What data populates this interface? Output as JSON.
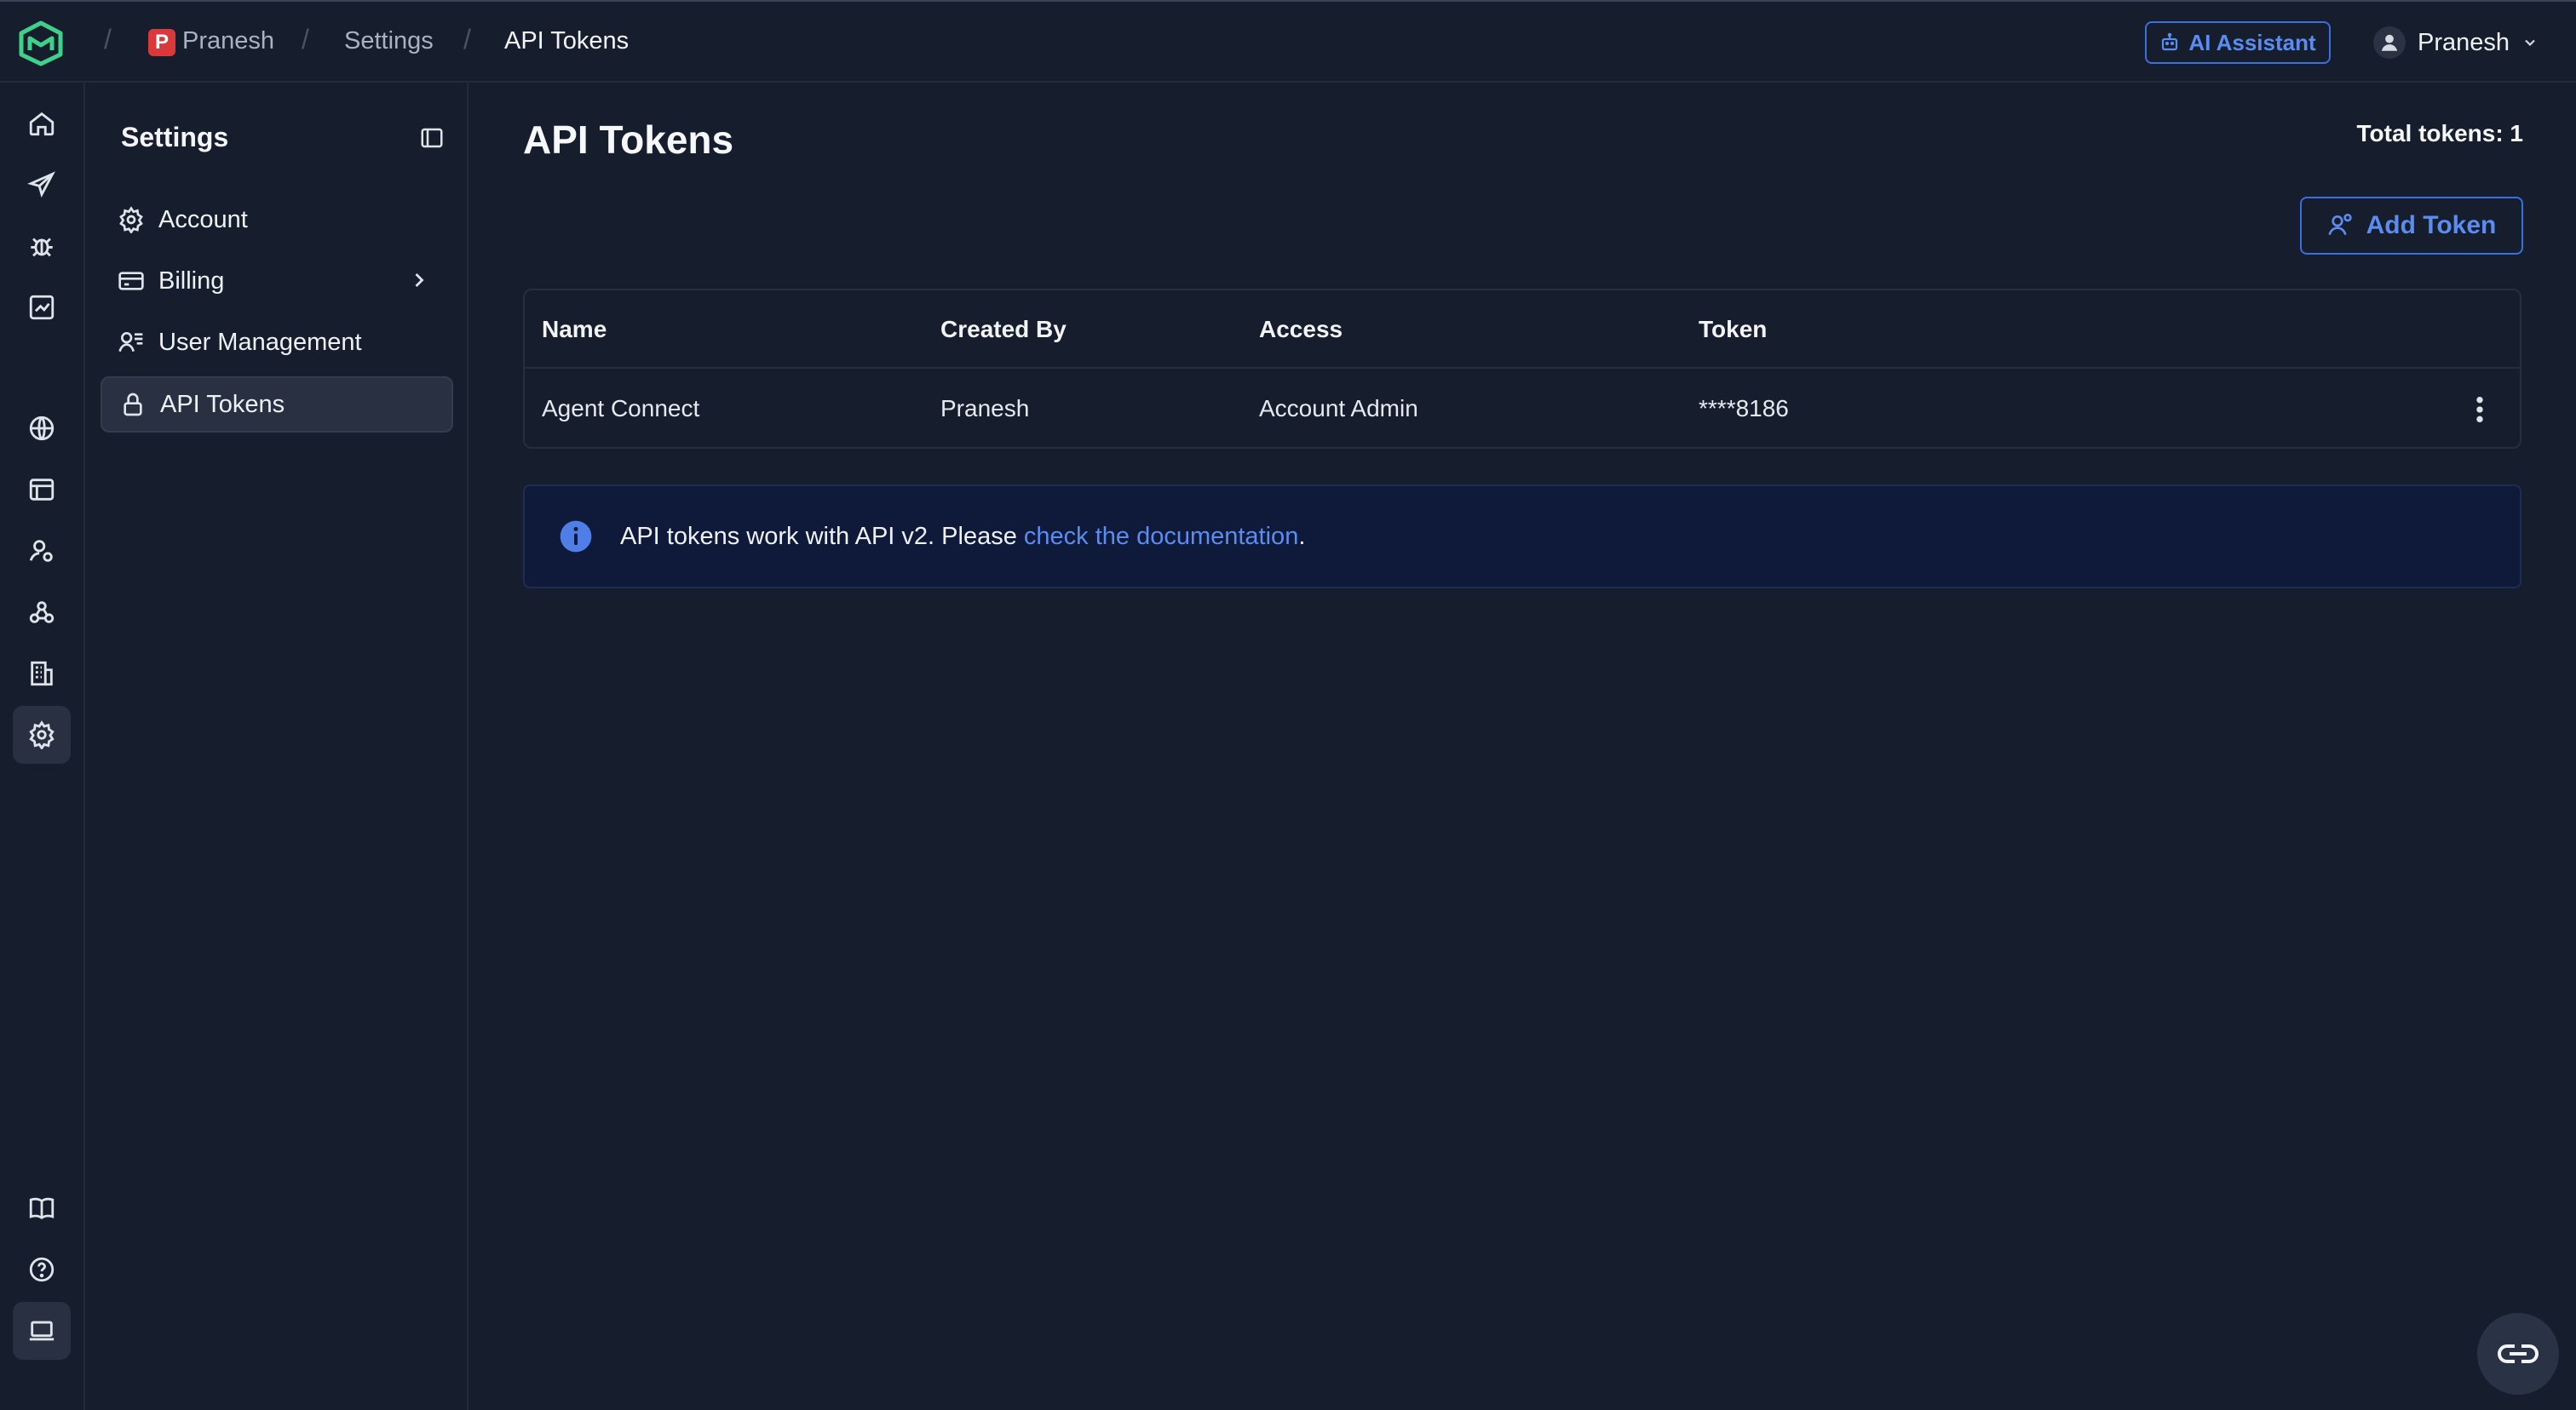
{
  "breadcrumb": {
    "org_initial": "P",
    "org_name": "Pranesh",
    "section": "Settings",
    "current": "API Tokens"
  },
  "header": {
    "ai_assistant_label": "AI Assistant",
    "user_name": "Pranesh"
  },
  "rail": {
    "items": [
      "home-icon",
      "send-icon",
      "bug-icon",
      "chart-icon",
      "globe-icon",
      "layout-icon",
      "user-settings-icon",
      "webhook-icon",
      "building-icon",
      "gear-icon",
      "book-icon",
      "help-icon",
      "monitor-icon"
    ],
    "active": "gear-icon"
  },
  "sidebar": {
    "title": "Settings",
    "items": [
      {
        "label": "Account",
        "icon": "gear-icon"
      },
      {
        "label": "Billing",
        "icon": "credit-card-icon"
      },
      {
        "label": "User Management",
        "icon": "users-list-icon"
      },
      {
        "label": "API Tokens",
        "icon": "lock-icon"
      }
    ],
    "active": "API Tokens"
  },
  "main": {
    "title": "API Tokens",
    "total_tokens": "Total tokens: 1",
    "add_token_label": "Add Token",
    "table": {
      "headers": [
        "Name",
        "Created By",
        "Access",
        "Token"
      ],
      "rows": [
        [
          "Agent Connect",
          "Pranesh",
          "Account Admin",
          "****8186"
        ]
      ]
    },
    "info": {
      "text": "API tokens work with API v2. Please ",
      "link_text": "check the documentation",
      "suffix": "."
    }
  },
  "colors": {
    "background": "#161d2c",
    "accent": "#5b8cf0",
    "info_bg": "#0f1a3a",
    "org_badge": "#d9393a",
    "logo": "#3fd08a"
  }
}
